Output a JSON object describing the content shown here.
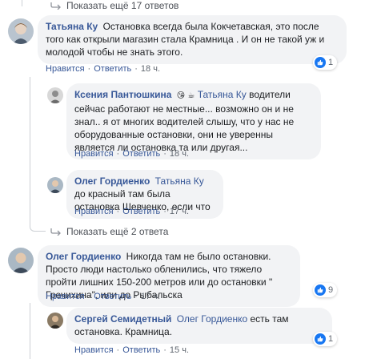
{
  "top_more_replies": "Показать ещё 17 ответов",
  "mid_more_replies": "Показать ещё 2 ответа",
  "colors": {
    "link": "#385898",
    "bubble": "#f2f3f5",
    "like": "#1877f2"
  },
  "comments": [
    {
      "author": "Татьяна Ку",
      "text": "Остановка всегда была Кокчетавская, это после того как открыли магазин стала Крамница . И он не такой уж и молодой чтобы не знать этого.",
      "like": "Нравится",
      "reply": "Ответить",
      "time": "18 ч.",
      "reactions": "1"
    },
    {
      "author": "Ксения Пантюшкина",
      "emoji": "😘 ☕",
      "mention": "Татьяна Ку",
      "text": "водители сейчас работают не местные... возможно он и не знал.. я от многих водителей слышу, что у нас не оборудованные остановки, они не уверенны является ли остановка та или другая...",
      "like": "Нравится",
      "reply": "Ответить",
      "time": "18 ч."
    },
    {
      "author": "Олег Гордиенко",
      "mention": "Татьяна Ку",
      "text": "до красный там была остановка Шевченко, если что",
      "like": "Нравится",
      "reply": "Ответить",
      "time": "17 ч."
    },
    {
      "author": "Олег Гордиенко",
      "text": "Никогда там не было остановки. Просто люди настолько обленились, что тяжело пройти лишних 150-200 метров или до остановки \" Гречихина\", или до Рыбальска",
      "like": "Нравится",
      "reply": "Ответить",
      "time": "17 ч.",
      "reactions": "9"
    },
    {
      "author": "Сергей Семидетный",
      "mention": "Олег Гордиенко",
      "text": "есть там остановка. Крамница.",
      "like": "Нравится",
      "reply": "Ответить",
      "time": "15 ч.",
      "reactions": "1"
    }
  ]
}
